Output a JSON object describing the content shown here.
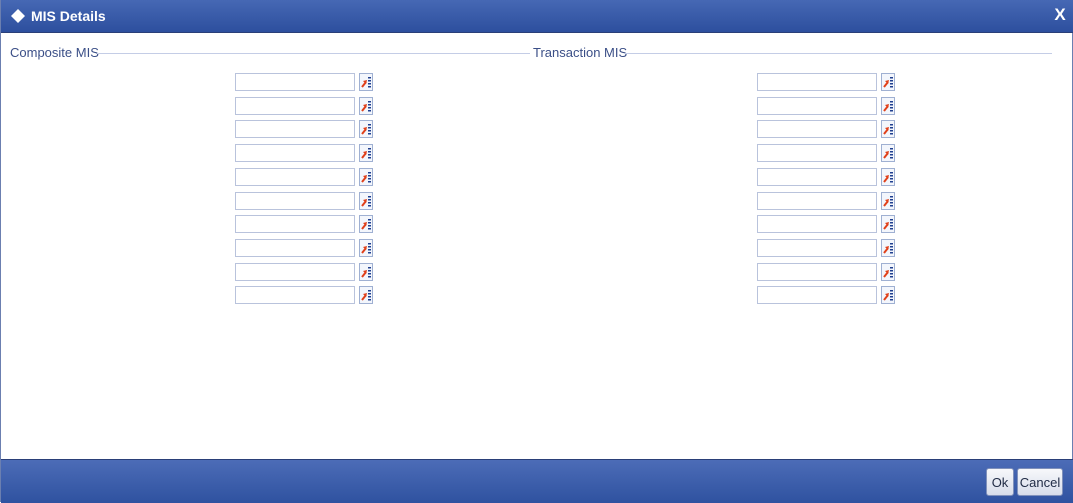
{
  "window": {
    "title": "MIS Details",
    "close_label": "X"
  },
  "sections": {
    "composite": {
      "title": "Composite MIS",
      "field_count": 10
    },
    "transaction": {
      "title": "Transaction MIS",
      "field_count": 10
    }
  },
  "fields": {
    "composite": [
      "",
      "",
      "",
      "",
      "",
      "",
      "",
      "",
      "",
      ""
    ],
    "transaction": [
      "",
      "",
      "",
      "",
      "",
      "",
      "",
      "",
      "",
      ""
    ]
  },
  "footer": {
    "ok_label": "Ok",
    "cancel_label": "Cancel"
  },
  "colors": {
    "titlebar": "#2d4f9e",
    "lov_icon_arrow": "#e0401a",
    "lov_icon_lines": "#1f3f8f"
  }
}
